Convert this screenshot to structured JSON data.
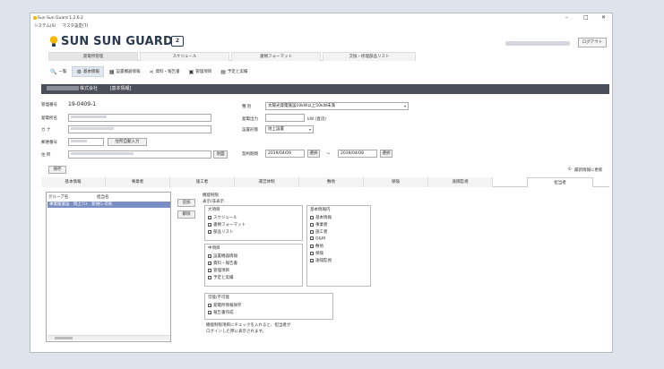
{
  "window": {
    "title": "Sun Sun Guard 1.2.6.2",
    "menu": [
      "システム(S)",
      "マスタ設定(T)"
    ],
    "controls": [
      "–",
      "□",
      "✕"
    ]
  },
  "header": {
    "logo_text": "SUN SUN GUARD",
    "logo_badge": "2",
    "logout_label": "ログアウト"
  },
  "top_tabs": [
    {
      "label": "発電所管理",
      "active": true
    },
    {
      "label": "スケジュール",
      "active": false
    },
    {
      "label": "書類フォーマット",
      "active": false
    },
    {
      "label": "交換・修理部品リスト",
      "active": false
    }
  ],
  "subnav": [
    {
      "icon": "search-icon",
      "glyph": "🔍",
      "label": "一覧",
      "active": false
    },
    {
      "icon": "gear-icon",
      "glyph": "⚙",
      "label": "基本情報",
      "active": true
    },
    {
      "icon": "grid-icon",
      "glyph": "▦",
      "label": "設置機器情報",
      "active": false
    },
    {
      "icon": "share-icon",
      "glyph": "⋖",
      "label": "資料・報告書",
      "active": false
    },
    {
      "icon": "clipboard-icon",
      "glyph": "▣",
      "label": "管理項目",
      "active": false
    },
    {
      "icon": "calendar-icon",
      "glyph": "▤",
      "label": "予定と実績",
      "active": false
    }
  ],
  "company_bar": {
    "company_suffix": "株式会社",
    "section": "[基本情報]"
  },
  "form": {
    "mgmt_no_label": "管理番号",
    "mgmt_no_value": "19-0409-1",
    "plant_name_label": "発電所名",
    "kana_label": "カ ナ",
    "postal_label": "郵便番号",
    "auto_address_btn": "住所自動入力",
    "address_label": "住 所",
    "map_btn": "地図",
    "type_label": "種 別",
    "type_value": "太陽光発電施設10kW以上50kW未満",
    "output_label": "発電出力",
    "output_unit": "kW (直流)",
    "install_label": "設置形態",
    "install_value": "地上設置",
    "contract_label": "契約期間",
    "contract_start": "2019/04/09",
    "contract_end": "2039/04/08",
    "select_label": "選択",
    "tilde": "〜",
    "save_btn": "保存",
    "refresh_label": "最新情報に更新",
    "refresh_glyph": "↻"
  },
  "section_tabs": [
    {
      "label": "基本情報",
      "active": false
    },
    {
      "label": "事業者",
      "active": false
    },
    {
      "label": "施工者",
      "active": false
    },
    {
      "label": "運営体制",
      "active": false
    },
    {
      "label": "敷地",
      "active": false
    },
    {
      "label": "保険",
      "active": false
    },
    {
      "label": "遠隔監視",
      "active": false
    },
    {
      "label": "担当者",
      "active": true
    }
  ],
  "group_list": {
    "col1": "グループ名",
    "col2": "担当名",
    "selected_row": "事業版施設　岡上ﾃｽﾄ　新規G 司商"
  },
  "side_buttons": {
    "add": "追加",
    "remove": "解除"
  },
  "permissions": {
    "title": "機能制限",
    "display_title": "表示/非表示",
    "major_title": "大項目",
    "major_items": [
      {
        "label": "スケジュール",
        "checked": true
      },
      {
        "label": "書類フォーマット",
        "checked": true
      },
      {
        "label": "部品リスト",
        "checked": true
      }
    ],
    "middle_title": "中項目",
    "middle_items": [
      {
        "label": "設置機器情報",
        "checked": true
      },
      {
        "label": "資料・報告書",
        "checked": true
      },
      {
        "label": "管理項目",
        "checked": true
      },
      {
        "label": "予定と実績",
        "checked": false
      }
    ],
    "basic_title": "基本情報内",
    "basic_items": [
      {
        "label": "基本情報",
        "checked": false
      },
      {
        "label": "事業者",
        "checked": false
      },
      {
        "label": "施工者",
        "checked": false
      },
      {
        "label": "O&M",
        "checked": true
      },
      {
        "label": "敷地",
        "checked": true
      },
      {
        "label": "保険",
        "checked": false
      },
      {
        "label": "遠隔監視",
        "checked": true
      }
    ],
    "enable_title": "可能/不可能",
    "enable_items": [
      {
        "label": "発電所情報保存",
        "checked": true
      },
      {
        "label": "報告書作成",
        "checked": true
      }
    ],
    "note_line1": "機能制限項目にチェックを入れると、担当者が",
    "note_line2": "ログインした際に表示されます。"
  },
  "colors": {
    "bar": "#4a4e58",
    "selection": "#7a8fc4",
    "logo": "#2a3a4e",
    "bulb": "#f5b700"
  }
}
